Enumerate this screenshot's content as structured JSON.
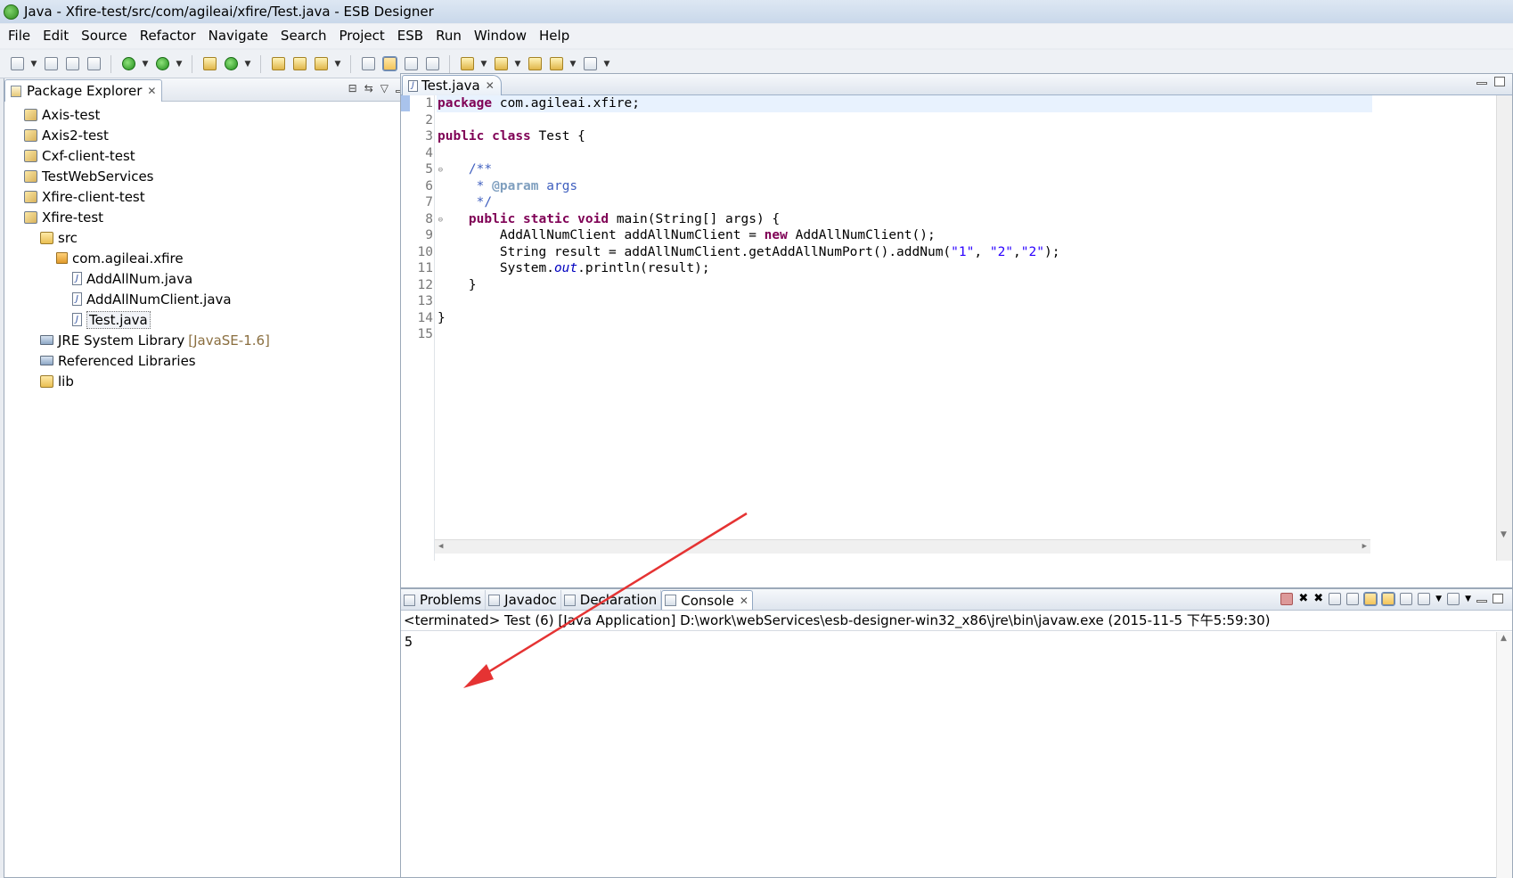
{
  "window": {
    "title": "Java - Xfire-test/src/com/agileai/xfire/Test.java - ESB Designer"
  },
  "menubar": {
    "items": [
      "File",
      "Edit",
      "Source",
      "Refactor",
      "Navigate",
      "Search",
      "Project",
      "ESB",
      "Run",
      "Window",
      "Help"
    ]
  },
  "package_explorer": {
    "title": "Package Explorer",
    "items": [
      {
        "label": "Axis-test",
        "icon": "project-icon",
        "indent": 0
      },
      {
        "label": "Axis2-test",
        "icon": "project-icon",
        "indent": 0
      },
      {
        "label": "Cxf-client-test",
        "icon": "project-icon",
        "indent": 0
      },
      {
        "label": "TestWebServices",
        "icon": "project-icon",
        "indent": 0
      },
      {
        "label": "Xfire-client-test",
        "icon": "project-icon",
        "indent": 0
      },
      {
        "label": "Xfire-test",
        "icon": "project-icon",
        "indent": 0
      },
      {
        "label": "src",
        "icon": "source-folder-icon",
        "indent": 1
      },
      {
        "label": "com.agileai.xfire",
        "icon": "package-icon",
        "indent": 2
      },
      {
        "label": "AddAllNum.java",
        "icon": "java-file-icon",
        "indent": 3
      },
      {
        "label": "AddAllNumClient.java",
        "icon": "java-file-icon",
        "indent": 3
      },
      {
        "label": "Test.java",
        "icon": "java-file-icon",
        "indent": 3,
        "selected": true
      },
      {
        "label": "JRE System Library",
        "suffix": "[JavaSE-1.6]",
        "icon": "library-icon",
        "indent": 1
      },
      {
        "label": "Referenced Libraries",
        "icon": "library-icon",
        "indent": 1
      },
      {
        "label": "lib",
        "icon": "folder-icon",
        "indent": 1
      }
    ]
  },
  "editor": {
    "tab_label": "Test.java",
    "line_numbers": [
      "1",
      "2",
      "3",
      "4",
      "5",
      "6",
      "7",
      "8",
      "9",
      "10",
      "11",
      "12",
      "13",
      "14",
      "15"
    ],
    "folded_lines": [
      5,
      8
    ]
  },
  "console": {
    "tabs": [
      "Problems",
      "Javadoc",
      "Declaration",
      "Console"
    ],
    "active_tab": "Console",
    "status": "<terminated> Test (6) [Java Application] D:\\work\\webServices\\esb-designer-win32_x86\\jre\\bin\\javaw.exe (2015-11-5 下午5:59:30)",
    "output": "5"
  },
  "colors": {
    "keyword": "#7f0055",
    "string": "#2a00ff",
    "javadoc": "#3f5fbf",
    "annotation_arrow": "#e53333"
  }
}
